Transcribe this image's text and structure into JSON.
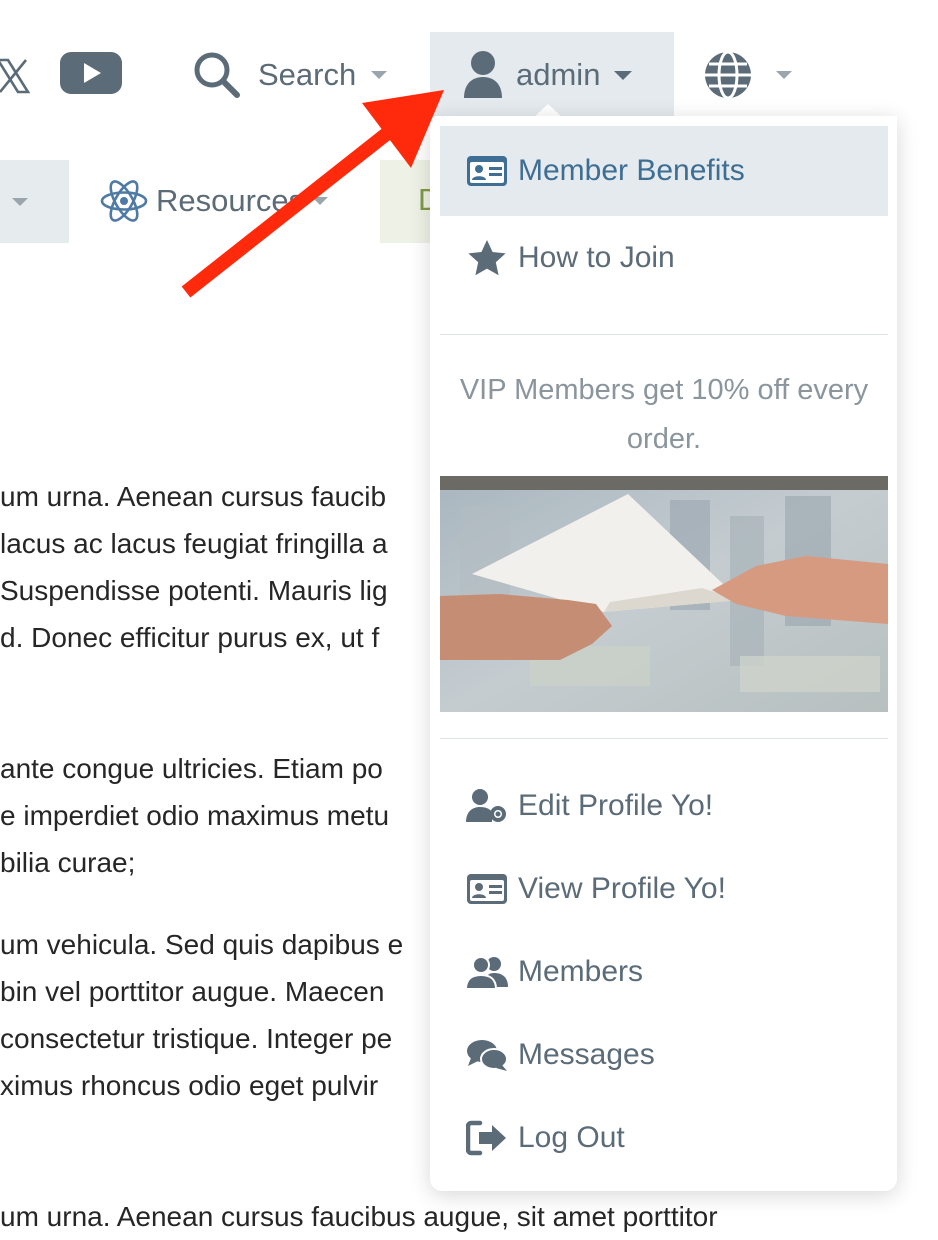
{
  "topbar": {
    "x_icon": "x-icon",
    "youtube_icon": "youtube-icon",
    "search_label": "Search",
    "user_label": "admin",
    "globe_icon": "globe-icon"
  },
  "secondary_nav": {
    "resources_label": "Resources",
    "partial_green_label": "D"
  },
  "body_paragraphs": [
    [
      "um urna. Aenean cursus faucib",
      "lacus ac lacus feugiat fringilla a",
      "Suspendisse potenti. Mauris lig",
      "d. Donec efficitur purus ex, ut f"
    ],
    [
      "ante congue ultricies. Etiam po",
      "e imperdiet odio maximus metu",
      "bilia curae;"
    ],
    [
      "um vehicula. Sed quis dapibus e",
      "bin vel porttitor augue. Maecen",
      "consectetur tristique. Integer pe",
      "ximus rhoncus odio eget pulvir"
    ],
    [
      "um urna. Aenean cursus faucibus augue, sit amet porttitor"
    ]
  ],
  "dropdown": {
    "items_top": [
      {
        "label": "Member Benefits",
        "icon": "id-card-icon",
        "active": true
      },
      {
        "label": "How to Join",
        "icon": "star-icon",
        "active": false
      }
    ],
    "promo_text": "VIP Members get 10% off every order.",
    "promo_image": "photo-hands-passing-paper",
    "items_bottom": [
      {
        "label": "Edit Profile Yo!",
        "icon": "user-gear-icon"
      },
      {
        "label": "View Profile Yo!",
        "icon": "id-card-icon"
      },
      {
        "label": "Members",
        "icon": "users-icon"
      },
      {
        "label": "Messages",
        "icon": "comments-icon"
      },
      {
        "label": "Log Out",
        "icon": "sign-out-icon"
      }
    ]
  },
  "annotation": {
    "arrow_color": "#ff2a0b"
  },
  "colors": {
    "menu_text": "#5b6b78",
    "active_text": "#3e6e93",
    "active_bg": "#e4eaee",
    "muted_text": "#8a959d"
  }
}
